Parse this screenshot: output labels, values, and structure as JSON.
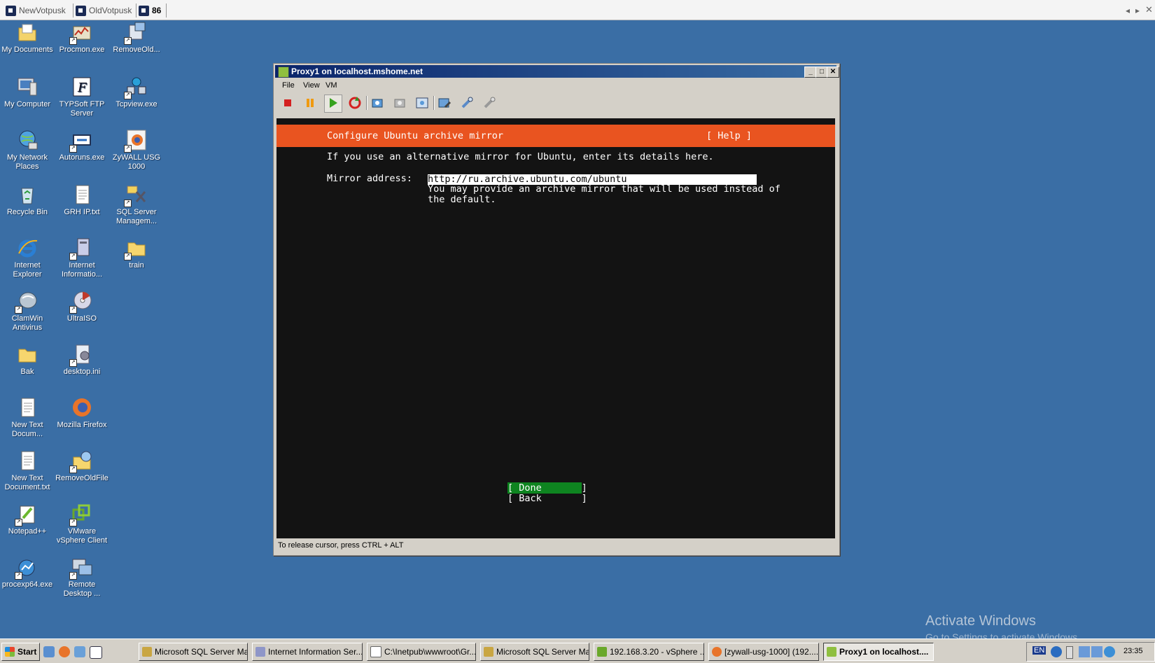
{
  "rdp_tabs": [
    {
      "label": "NewVotpusk"
    },
    {
      "label": "OldVotpusk"
    },
    {
      "label": "86"
    }
  ],
  "desktop_icons": [
    {
      "label": "My Documents",
      "icon": "folder-documents-icon"
    },
    {
      "label": "Procmon.exe",
      "icon": "procmon-icon"
    },
    {
      "label": "RemoveOld...",
      "icon": "remove-old-icon"
    },
    {
      "label": "My Computer",
      "icon": "computer-icon"
    },
    {
      "label": "TYPSoft FTP Server",
      "icon": "ftp-server-icon"
    },
    {
      "label": "Tcpview.exe",
      "icon": "tcpview-icon"
    },
    {
      "label": "My Network Places",
      "icon": "network-icon"
    },
    {
      "label": "Autoruns.exe",
      "icon": "autoruns-icon"
    },
    {
      "label": "ZyWALL USG 1000",
      "icon": "firefox-shortcut-icon"
    },
    {
      "label": "Recycle Bin",
      "icon": "recycle-bin-icon"
    },
    {
      "label": "GRH IP.txt",
      "icon": "text-file-icon"
    },
    {
      "label": "SQL Server Managem...",
      "icon": "sql-server-icon"
    },
    {
      "label": "Internet Explorer",
      "icon": "internet-explorer-icon"
    },
    {
      "label": "Internet Informatio...",
      "icon": "iis-icon"
    },
    {
      "label": "train",
      "icon": "folder-icon"
    },
    {
      "label": "ClamWin Antivirus",
      "icon": "clamwin-icon"
    },
    {
      "label": "UltraISO",
      "icon": "ultraiso-icon"
    },
    {
      "label": "Bak",
      "icon": "folder-icon"
    },
    {
      "label": "desktop.ini",
      "icon": "ini-file-icon"
    },
    {
      "label": "New Text Docum...",
      "icon": "text-file-icon"
    },
    {
      "label": "Mozilla Firefox",
      "icon": "firefox-icon"
    },
    {
      "label": "New Text Document.txt",
      "icon": "text-file-icon"
    },
    {
      "label": "RemoveOldFile",
      "icon": "remove-old-icon"
    },
    {
      "label": "Notepad++",
      "icon": "notepad-plus-icon"
    },
    {
      "label": "VMware vSphere Client",
      "icon": "vsphere-icon"
    },
    {
      "label": "procexp64.exe",
      "icon": "procexp-icon"
    },
    {
      "label": "Remote Desktop ...",
      "icon": "remote-desktop-icon"
    }
  ],
  "vm_window": {
    "title": "Proxy1 on localhost.mshome.net",
    "menu": [
      "File",
      "View",
      "VM"
    ],
    "status": "To release cursor, press CTRL + ALT"
  },
  "installer": {
    "header": "Configure Ubuntu archive mirror",
    "help": "[ Help ]",
    "intro": "If you use an alternative mirror for Ubuntu, enter its details here.",
    "mirror_label": "Mirror address:",
    "mirror_value": "http://ru.archive.ubuntu.com/ubuntu",
    "hint_line1": "You may provide an archive mirror that will be used instead of",
    "hint_line2": "the default.",
    "done": "[ Done       ]",
    "back": "[ Back       ]"
  },
  "watermark": {
    "line1": "Activate Windows",
    "line2": "Go to Settings to activate Windows."
  },
  "taskbar": {
    "start": "Start",
    "tasks": [
      "Microsoft SQL Server Ma...",
      "Internet Information Ser...",
      "C:\\Inetpub\\wwwroot\\Gr...",
      "Microsoft SQL Server Ma...",
      "192.168.3.20 - vSphere ...",
      "[zywall-usg-1000] (192....",
      "Proxy1 on localhost...."
    ],
    "lang": "EN",
    "clock": "23:35"
  },
  "colors": {
    "desktop": "#3a6ea5",
    "ubuntu_orange": "#e95420",
    "done_green": "#0e8420",
    "console_bg": "#131313"
  }
}
